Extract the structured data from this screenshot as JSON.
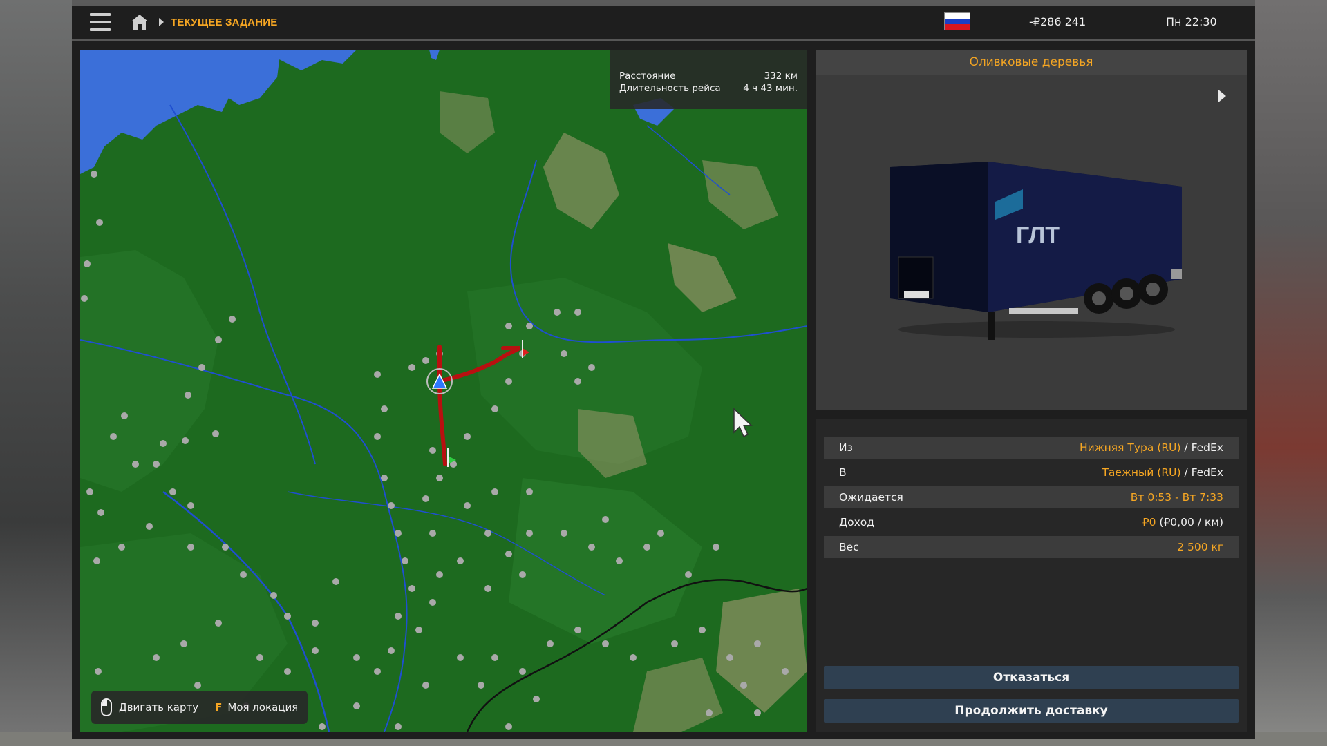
{
  "header": {
    "breadcrumb": "ТЕКУЩЕЕ ЗАДАНИЕ",
    "money": "-₽286 241",
    "clock": "Пн 22:30",
    "flag_colors": [
      "#ffffff",
      "#1c3fc4",
      "#d8161e"
    ]
  },
  "route_info": {
    "distance_label": "Расстояние",
    "distance_value": "332 км",
    "duration_label": "Длительность рейса",
    "duration_value": "4 ч 43 мин."
  },
  "map_hints": {
    "move_map": "Двигать карту",
    "my_location_key": "F",
    "my_location": "Моя локация"
  },
  "cargo": {
    "name": "Оливковые деревья",
    "trailer_brand": "ГЛТ"
  },
  "details": {
    "from_label": "Из",
    "from_city": "Нижняя Тура (RU)",
    "from_company": " / FedEx",
    "to_label": "В",
    "to_city": "Таежный (RU)",
    "to_company": " / FedEx",
    "expected_label": "Ожидается",
    "expected_value": "Вт 0:53 - Вт 7:33",
    "income_label": "Доход",
    "income_value": "₽0",
    "income_rate": " (₽0,00 / км)",
    "weight_label": "Вес",
    "weight_value": "2 500 кг"
  },
  "buttons": {
    "decline": "Отказаться",
    "continue": "Продолжить доставку"
  },
  "colors": {
    "accent": "#f5a623",
    "map_green": "#1d6a1f",
    "route_red": "#c01414",
    "button_blue": "#2f4051"
  }
}
